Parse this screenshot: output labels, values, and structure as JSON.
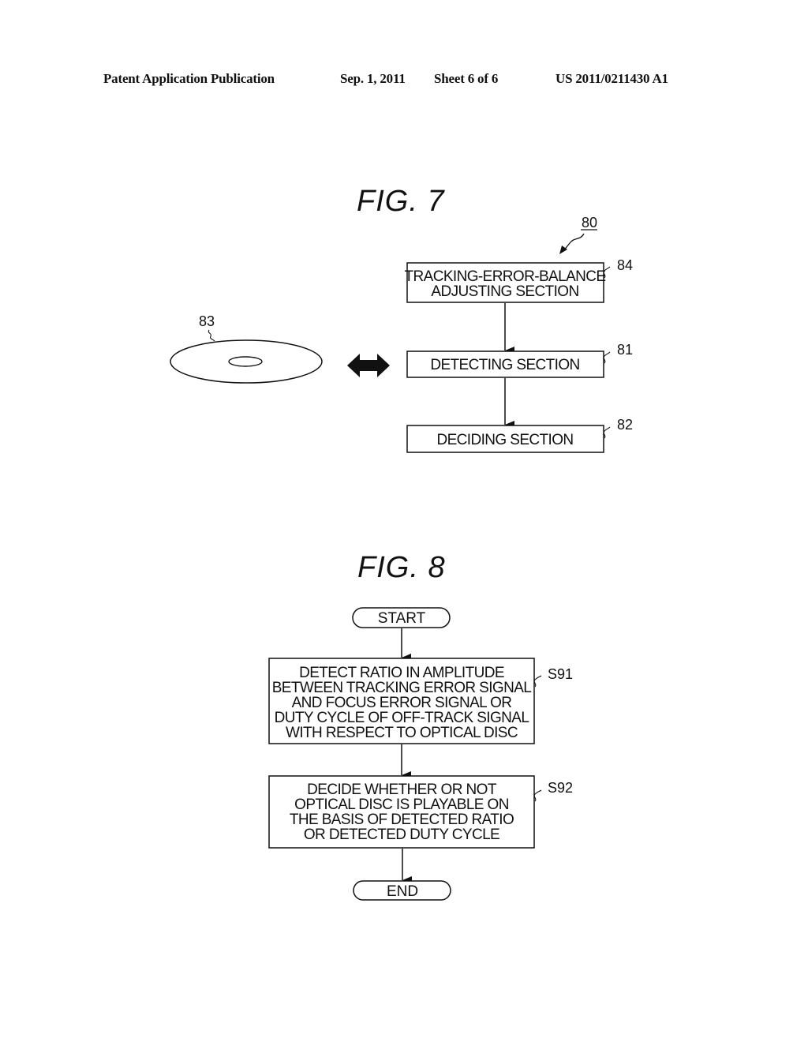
{
  "header": {
    "publication": "Patent Application Publication",
    "date": "Sep. 1, 2011",
    "sheet": "Sheet 6 of 6",
    "number": "US 2011/0211430 A1"
  },
  "fig7": {
    "title": "FIG.  7",
    "system_ref": "80",
    "disc_ref": "83",
    "blocks": [
      {
        "ref": "84",
        "lines": [
          "TRACKING-ERROR-BALANCE",
          "ADJUSTING SECTION"
        ]
      },
      {
        "ref": "81",
        "lines": [
          "DETECTING SECTION"
        ]
      },
      {
        "ref": "82",
        "lines": [
          "DECIDING SECTION"
        ]
      }
    ]
  },
  "fig8": {
    "title": "FIG.  8",
    "start_label": "START",
    "end_label": "END",
    "steps": [
      {
        "ref": "S91",
        "lines": [
          "DETECT RATIO IN AMPLITUDE",
          "BETWEEN TRACKING ERROR SIGNAL",
          "AND FOCUS ERROR SIGNAL OR",
          "DUTY CYCLE OF OFF-TRACK SIGNAL",
          "WITH RESPECT TO OPTICAL DISC"
        ]
      },
      {
        "ref": "S92",
        "lines": [
          "DECIDE WHETHER OR NOT",
          "OPTICAL DISC IS PLAYABLE ON",
          "THE BASIS OF DETECTED RATIO",
          "OR DETECTED DUTY CYCLE"
        ]
      }
    ]
  }
}
